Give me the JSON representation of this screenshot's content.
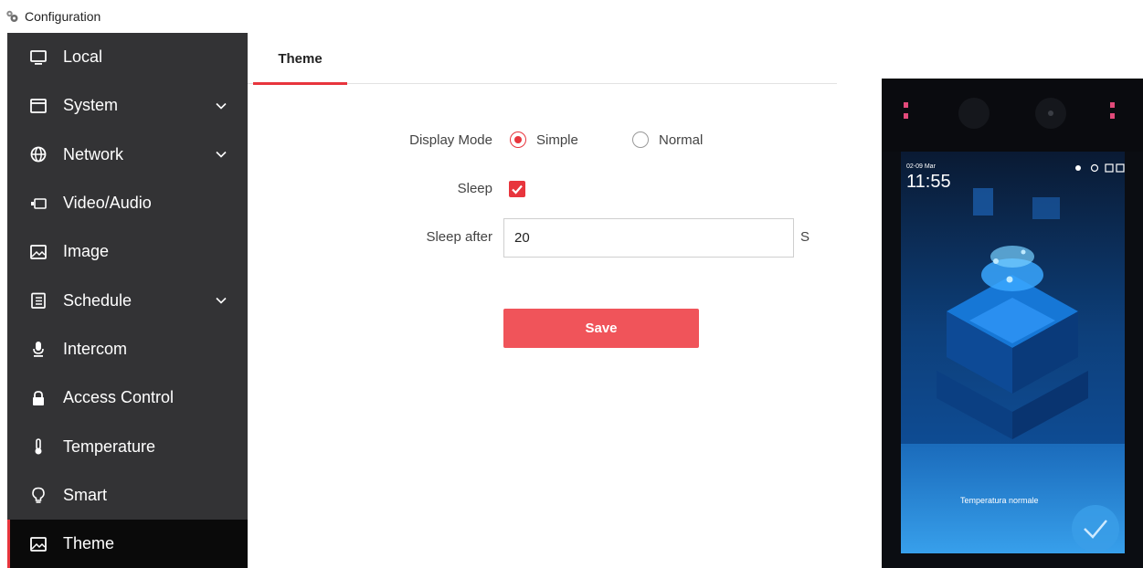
{
  "window": {
    "title": "Configuration",
    "app_icon": "gear-cluster-icon"
  },
  "sidebar": {
    "items": [
      {
        "label": "Local",
        "icon": "monitor-icon",
        "expandable": false,
        "active": false
      },
      {
        "label": "System",
        "icon": "window-icon",
        "expandable": true,
        "active": false
      },
      {
        "label": "Network",
        "icon": "globe-icon",
        "expandable": true,
        "active": false
      },
      {
        "label": "Video/Audio",
        "icon": "camera-icon",
        "expandable": false,
        "active": false
      },
      {
        "label": "Image",
        "icon": "image-icon",
        "expandable": false,
        "active": false
      },
      {
        "label": "Schedule",
        "icon": "clipboard-icon",
        "expandable": true,
        "active": false
      },
      {
        "label": "Intercom",
        "icon": "microphone-icon",
        "expandable": false,
        "active": false
      },
      {
        "label": "Access Control",
        "icon": "lock-icon",
        "expandable": false,
        "active": false
      },
      {
        "label": "Temperature",
        "icon": "thermometer-icon",
        "expandable": false,
        "active": false
      },
      {
        "label": "Smart",
        "icon": "bulb-icon",
        "expandable": false,
        "active": false
      },
      {
        "label": "Theme",
        "icon": "image-icon",
        "expandable": false,
        "active": true
      }
    ]
  },
  "tabs": [
    {
      "label": "Theme",
      "active": true
    }
  ],
  "form": {
    "display_mode": {
      "label": "Display Mode",
      "options": [
        {
          "label": "Simple",
          "selected": true
        },
        {
          "label": "Normal",
          "selected": false
        }
      ]
    },
    "sleep": {
      "label": "Sleep",
      "checked": true
    },
    "sleep_after": {
      "label": "Sleep after",
      "value": "20",
      "unit": "S"
    },
    "save_label": "Save"
  },
  "device_screen": {
    "date": "02-09 Mar",
    "time": "11:55",
    "status_text": "Temperatura normale"
  },
  "colors": {
    "accent": "#e8353d",
    "sidebar_bg": "#333335",
    "sidebar_active_bg": "#0a0a0a",
    "save_button": "#f0545a"
  }
}
